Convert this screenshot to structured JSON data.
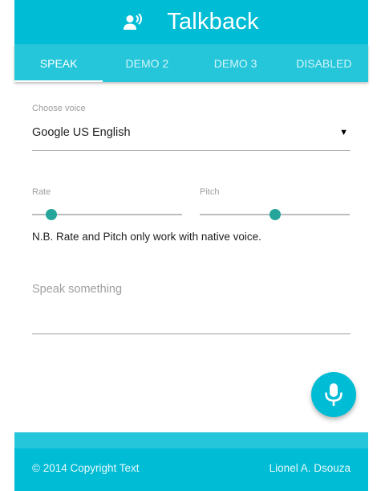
{
  "header": {
    "title": "Talkback",
    "icon": "record-voice-icon"
  },
  "tabs": [
    {
      "label": "SPEAK",
      "active": true
    },
    {
      "label": "DEMO 2",
      "active": false
    },
    {
      "label": "DEMO 3",
      "active": false
    },
    {
      "label": "DISABLED",
      "active": false
    }
  ],
  "voice": {
    "label": "Choose voice",
    "selected": "Google US English",
    "caret": "▼"
  },
  "rate": {
    "label": "Rate",
    "value_fraction": 0.13
  },
  "pitch": {
    "label": "Pitch",
    "value_fraction": 0.5
  },
  "note": "N.B. Rate and Pitch only work with native voice.",
  "speak": {
    "placeholder": "Speak something",
    "value": ""
  },
  "fab": {
    "icon": "microphone-icon"
  },
  "footer": {
    "copyright": "© 2014 Copyright Text",
    "author": "Lionel A. Dsouza"
  },
  "colors": {
    "primary": "#00bcd4",
    "tabs_bg": "#26c6da",
    "slider_thumb": "#26a69a"
  }
}
